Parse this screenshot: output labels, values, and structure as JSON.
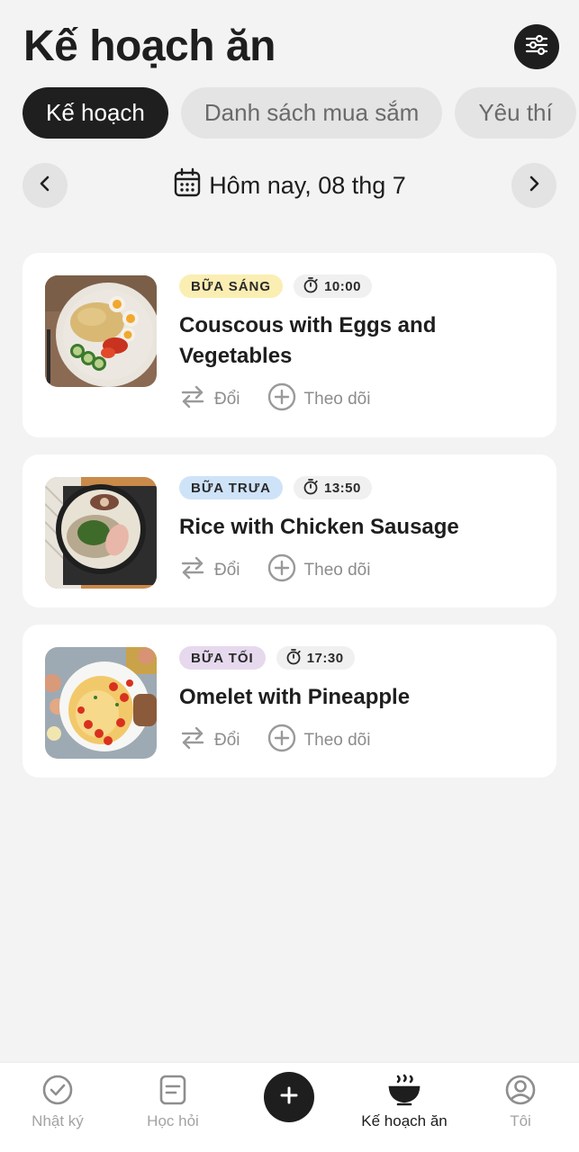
{
  "header": {
    "title": "Kế hoạch ăn",
    "filter_icon": "sliders-icon"
  },
  "tabs": [
    {
      "label": "Kế hoạch",
      "active": true
    },
    {
      "label": "Danh sách mua sắm",
      "active": false
    },
    {
      "label": "Yêu thí",
      "active": false
    }
  ],
  "date_bar": {
    "prev_icon": "chevron-left-icon",
    "calendar_icon": "calendar-icon",
    "label": "Hôm nay, 08 thg 7",
    "next_icon": "chevron-right-icon"
  },
  "meals": [
    {
      "tag": "BỮA SÁNG",
      "tag_color": "#fbeeb3",
      "time": "10:00",
      "title": "Couscous with Eggs and Vegetables",
      "swap_label": "Đổi",
      "track_label": "Theo dõi"
    },
    {
      "tag": "BỮA TRƯA",
      "tag_color": "#cfe3f8",
      "time": "13:50",
      "title": "Rice with Chicken Sausage",
      "swap_label": "Đổi",
      "track_label": "Theo dõi"
    },
    {
      "tag": "BỮA TỐI",
      "tag_color": "#e6d9ee",
      "time": "17:30",
      "title": "Omelet with Pineapple",
      "swap_label": "Đổi",
      "track_label": "Theo dõi"
    }
  ],
  "bottom_nav": {
    "items": [
      {
        "label": "Nhật ký",
        "icon": "check-circle-icon",
        "active": false
      },
      {
        "label": "Học hỏi",
        "icon": "note-icon",
        "active": false
      },
      {
        "label": "Kế hoạch ăn",
        "icon": "bowl-icon",
        "active": true
      },
      {
        "label": "Tôi",
        "icon": "user-circle-icon",
        "active": false
      }
    ],
    "add_icon": "plus-icon"
  },
  "colors": {
    "background": "#f3f3f3",
    "primary_dark": "#1e1e1e",
    "muted": "#8c8c8c"
  }
}
